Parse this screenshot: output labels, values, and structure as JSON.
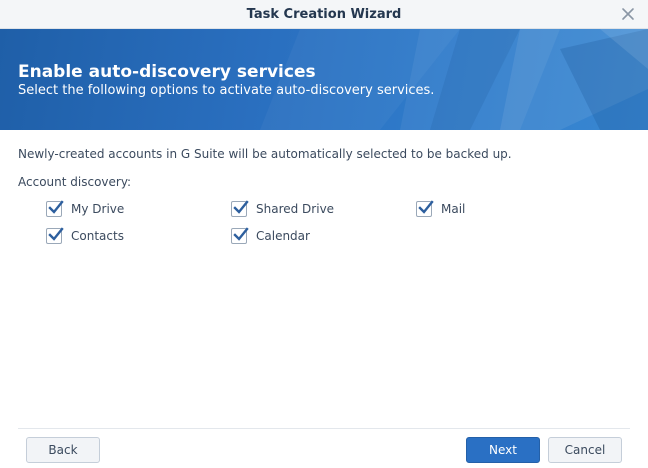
{
  "window": {
    "title": "Task Creation Wizard",
    "close_icon": "close-icon"
  },
  "banner": {
    "heading": "Enable auto-discovery services",
    "subheading": "Select the following options to activate auto-discovery services."
  },
  "content": {
    "info_text": "Newly-created accounts in G Suite will be automatically selected to be backed up.",
    "section_label": "Account discovery:",
    "options": [
      {
        "label": "My Drive",
        "checked": true
      },
      {
        "label": "Shared Drive",
        "checked": true
      },
      {
        "label": "Mail",
        "checked": true
      },
      {
        "label": "Contacts",
        "checked": true
      },
      {
        "label": "Calendar",
        "checked": true
      }
    ]
  },
  "footer": {
    "back_label": "Back",
    "next_label": "Next",
    "cancel_label": "Cancel"
  },
  "colors": {
    "accent": "#2a70c4",
    "banner": "#2a6fbf",
    "checkmark": "#2d5f9e"
  }
}
